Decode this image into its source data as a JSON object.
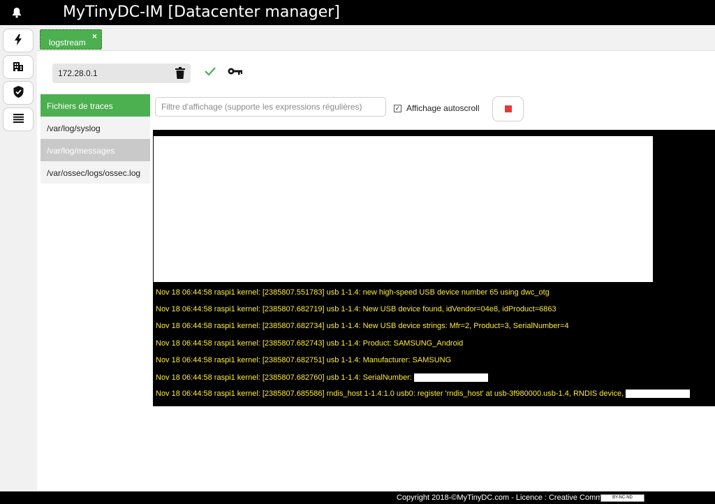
{
  "app": {
    "title": "MyTinyDC-IM [Datacenter manager]"
  },
  "sidebar": {
    "items": [
      {
        "icon": "lightning-icon"
      },
      {
        "icon": "building-icon"
      },
      {
        "icon": "shield-icon"
      },
      {
        "icon": "list-icon"
      }
    ]
  },
  "tabs": [
    {
      "label": "logstream",
      "close": "×"
    }
  ],
  "host": {
    "ip": "172.28.0.1"
  },
  "traces": {
    "header": "Fichiers de traces",
    "files": [
      "/var/log/syslog",
      "/var/log/messages",
      "/var/ossec/logs/ossec.log"
    ],
    "selected_index": 1
  },
  "filter": {
    "placeholder": "Filtre d'affichage (supporte les expressions régulières)",
    "value": ""
  },
  "autoscroll": {
    "label": "Affichage autoscroll",
    "checked": true
  },
  "log": {
    "lines": [
      "Nov 18 06:44:58 raspi1 kernel: [2385807.551783] usb 1-1.4: new high-speed USB device number 65 using dwc_otg",
      "Nov 18 06:44:58 raspi1 kernel: [2385807.682719] usb 1-1.4: New USB device found, idVendor=04e8, idProduct=6863",
      "Nov 18 06:44:58 raspi1 kernel: [2385807.682734] usb 1-1.4: New USB device strings: Mfr=2, Product=3, SerialNumber=4",
      "Nov 18 06:44:58 raspi1 kernel: [2385807.682743] usb 1-1.4: Product: SAMSUNG_Android",
      "Nov 18 06:44:58 raspi1 kernel: [2385807.682751] usb 1-1.4: Manufacturer: SAMSUNG",
      "Nov 18 06:44:58 raspi1 kernel: [2385807.682760] usb 1-1.4: SerialNumber:",
      "Nov 18 06:44:58 raspi1 kernel: [2385807.685586] rndis_host 1-1.4:1.0 usb0: register 'rndis_host' at usb-3f980000.usb-1.4, RNDIS device,"
    ],
    "text_color": "#ffeb3b"
  },
  "footer": {
    "text": "Copyright 2018-©MyTinyDC.com - Licence : Creative Commons",
    "badge": "BY-NC-ND"
  },
  "colors": {
    "accent": "#4caf50",
    "stop": "#e53935",
    "topbar": "#000000"
  }
}
